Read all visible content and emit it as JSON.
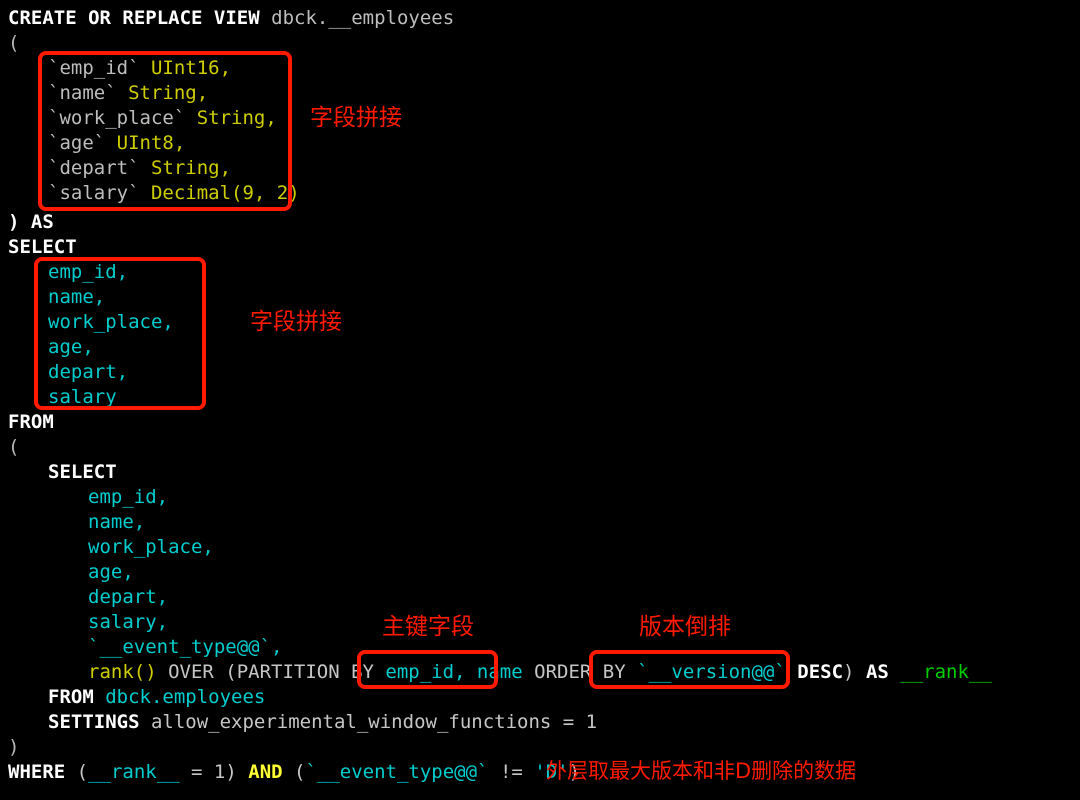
{
  "editor": {
    "background": "#000000",
    "default_text_color": "#d0d0d0",
    "highlight_color": "#ff1a00",
    "keyword_color": "#ffffff",
    "type_color": "#cdcd00",
    "identifier_color": "#00cdcd",
    "alias_color": "#00cd00"
  },
  "code": {
    "line_01": "CREATE OR REPLACE VIEW",
    "line_01_target": "dbck.__employees",
    "line_02": "(",
    "col_1_name": "`emp_id`",
    "col_1_type": "UInt16,",
    "col_2_name": "`name`",
    "col_2_type": "String,",
    "col_3_name": "`work_place`",
    "col_3_type": "String,",
    "col_4_name": "`age`",
    "col_4_type": "UInt8,",
    "col_5_name": "`depart`",
    "col_5_type": "String,",
    "col_6_name": "`salary`",
    "col_6_type": "Decimal(9, 2)",
    "line_close_as": ") AS",
    "line_select_outer": "SELECT",
    "outer_f1": "emp_id,",
    "outer_f2": "name,",
    "outer_f3": "work_place,",
    "outer_f4": "age,",
    "outer_f5": "depart,",
    "outer_f6": "salary",
    "line_from": "FROM",
    "line_open_paren": "(",
    "line_select_inner": "SELECT",
    "inner_f1": "emp_id,",
    "inner_f2": "name,",
    "inner_f3": "work_place,",
    "inner_f4": "age,",
    "inner_f5": "depart,",
    "inner_f6": "salary,",
    "inner_f7": "`__event_type@@`,",
    "rank_fn": "rank()",
    "rank_over": " OVER (PARTITION BY ",
    "rank_partition_keys": "emp_id, name",
    "rank_orderby": " ORDER BY ",
    "rank_version_col": "`__version@@`",
    "rank_desc": "DESC",
    "rank_close_paren": ")",
    "rank_as": "AS",
    "rank_alias": "__rank__",
    "from_kw": "FROM",
    "from_table": "dbck.employees",
    "settings_kw": "SETTINGS",
    "settings_expr": "allow_experimental_window_functions = 1",
    "line_close_paren": ")",
    "where_kw": "WHERE",
    "where_part1": " (",
    "where_rank": "__rank__",
    "where_eq": " = 1) ",
    "where_and": "AND",
    "where_part2": " (",
    "where_event_col": "`__event_type@@`",
    "where_neq": " != ",
    "where_value": "'D'",
    "where_close": ")"
  },
  "annotations": [
    {
      "id": "annot-fields-ddl",
      "text": "字段拼接"
    },
    {
      "id": "annot-fields-select",
      "text": "字段拼接"
    },
    {
      "id": "annot-primary-key",
      "text": "主键字段"
    },
    {
      "id": "annot-version-desc",
      "text": "版本倒排"
    },
    {
      "id": "annot-outer-note",
      "text": "外层取最大版本和非D删除的数据"
    }
  ],
  "highlight_boxes": [
    {
      "id": "box-ddl-columns",
      "label": "ddl-column-list"
    },
    {
      "id": "box-select-fields",
      "label": "outer-select-field-list"
    },
    {
      "id": "box-partition-keys",
      "label": "partition-by-keys"
    },
    {
      "id": "box-order-version",
      "label": "order-by-version-desc"
    }
  ]
}
